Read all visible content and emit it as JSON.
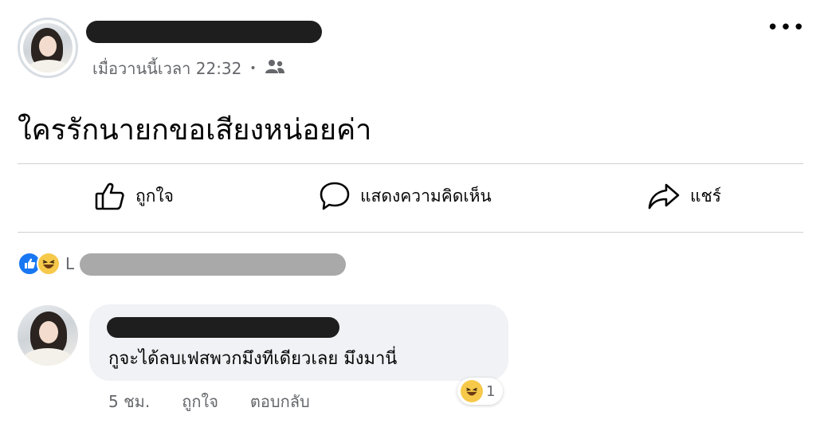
{
  "post": {
    "timestamp": "เมื่อวานนี้เวลา 22:32",
    "separator": "•",
    "audience_icon": "friends-icon",
    "more_label": "•••",
    "text": "ใครรักนายกขอเสียงหน่อยค่า"
  },
  "actions": {
    "like_label": "ถูกใจ",
    "comment_label": "แสดงความคิดเห็น",
    "share_label": "แชร์"
  },
  "reactions": {
    "icons": [
      "like-icon",
      "haha-icon"
    ],
    "visible_text": "L"
  },
  "comment": {
    "text": "กูจะได้ลบเฟสพวกมึงทีเดียวเลย มึงมานี่",
    "time": "5 ชม.",
    "like_label": "ถูกใจ",
    "reply_label": "ตอบกลับ",
    "reaction_count": "1"
  },
  "colors": {
    "like_blue": "#1877f2",
    "haha_yellow": "#f7c94a",
    "secondary_text": "#65676b",
    "bubble_bg": "#f0f2f5"
  }
}
